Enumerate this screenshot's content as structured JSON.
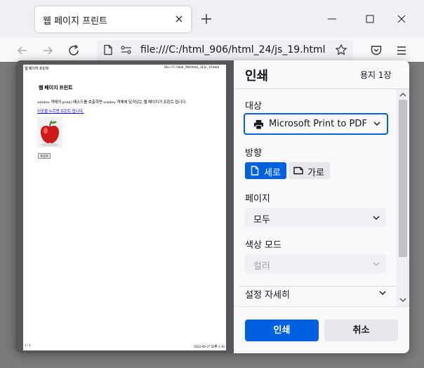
{
  "browser": {
    "tab": {
      "title": "웹 페이지 프린트",
      "close_icon": "close-icon"
    },
    "url": "file:///C:/html_906/html_24/js_19.html"
  },
  "print_preview": {
    "header_left": "웹 페이지 프린트",
    "header_right": "file:///C:/html_906/html_24/js_19.html",
    "heading": "웹 페이지 프린트",
    "description": "window 객체의 print() 메소드를 호출하면 window 객체에 담겨있는 웹 페이지가 프린트 됩니다.",
    "link_text": "이곳을 누르면 프린트 됩니다.",
    "button_text": "프린트",
    "footer_left": "1 / 1",
    "footer_right": "2022-09-27 오후 2:10"
  },
  "print_settings": {
    "title": "인쇄",
    "sheet_count": "용지 1장",
    "destination": {
      "label": "대상",
      "value": "Microsoft Print to PDF"
    },
    "orientation": {
      "label": "방향",
      "portrait": "세로",
      "landscape": "가로",
      "selected": "portrait"
    },
    "pages": {
      "label": "페이지",
      "value": "모두"
    },
    "color_mode": {
      "label": "색상 모드",
      "value": "컬러"
    },
    "more_settings": "설정 자세히",
    "print_button": "인쇄",
    "cancel_button": "취소"
  },
  "colors": {
    "accent": "#0061e0",
    "preview_background": "#57575b",
    "overlay": "#7b7b7d"
  }
}
